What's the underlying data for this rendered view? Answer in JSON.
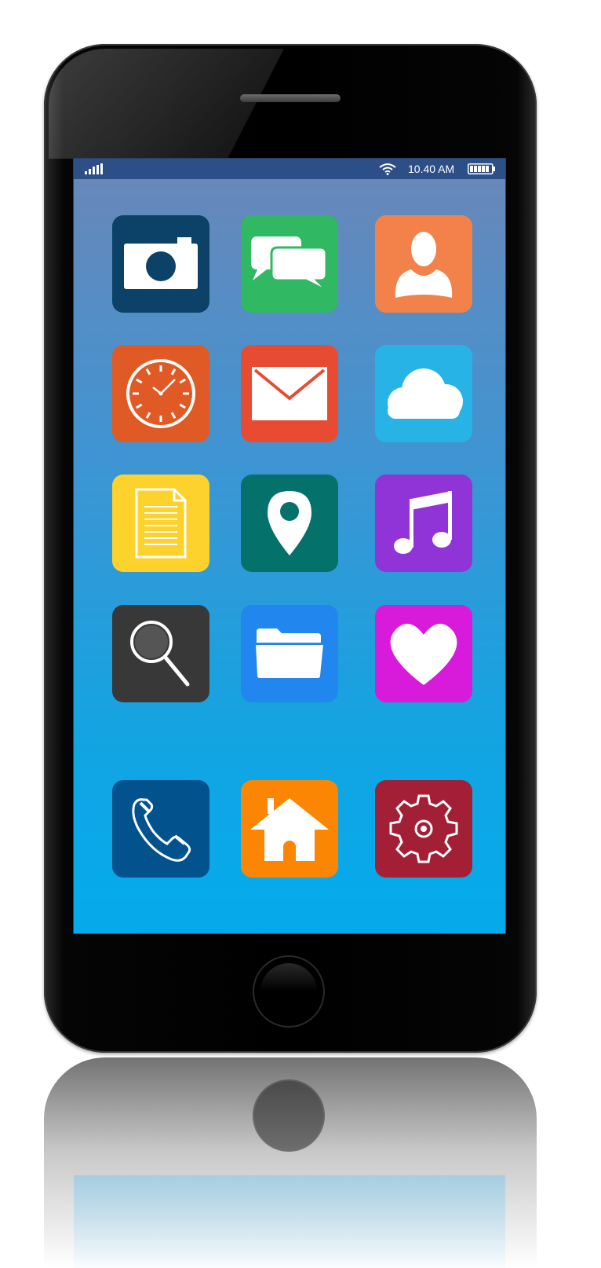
{
  "status_bar": {
    "time": "10.40 AM",
    "icons": [
      "signal-icon",
      "wifi-icon",
      "battery-icon"
    ]
  },
  "screen_gradient": [
    "#6b86b8",
    "#04abec"
  ],
  "apps": [
    {
      "id": "camera",
      "icon": "camera-icon",
      "color": "#0c4268"
    },
    {
      "id": "messages",
      "icon": "chat-bubbles-icon",
      "color": "#30b863"
    },
    {
      "id": "contacts",
      "icon": "person-icon",
      "color": "#f2824a"
    },
    {
      "id": "clock",
      "icon": "clock-icon",
      "color": "#e05a25"
    },
    {
      "id": "mail",
      "icon": "envelope-icon",
      "color": "#e74c33"
    },
    {
      "id": "cloud",
      "icon": "cloud-icon",
      "color": "#27b3e6"
    },
    {
      "id": "notes",
      "icon": "document-icon",
      "color": "#fdd22c"
    },
    {
      "id": "maps",
      "icon": "location-pin-icon",
      "color": "#04726b"
    },
    {
      "id": "music",
      "icon": "music-note-icon",
      "color": "#9034d8"
    },
    {
      "id": "search",
      "icon": "magnifier-icon",
      "color": "#383838"
    },
    {
      "id": "files",
      "icon": "folder-icon",
      "color": "#2187ee"
    },
    {
      "id": "favorites",
      "icon": "heart-icon",
      "color": "#d81adb"
    }
  ],
  "dock": [
    {
      "id": "phone",
      "icon": "phone-handset-icon",
      "color": "#02528e"
    },
    {
      "id": "home",
      "icon": "house-icon",
      "color": "#fb8603"
    },
    {
      "id": "settings",
      "icon": "gear-icon",
      "color": "#a31f35"
    }
  ],
  "hardware": {
    "body_color": "#000000",
    "icons": [
      "speaker-grille",
      "home-button"
    ]
  }
}
